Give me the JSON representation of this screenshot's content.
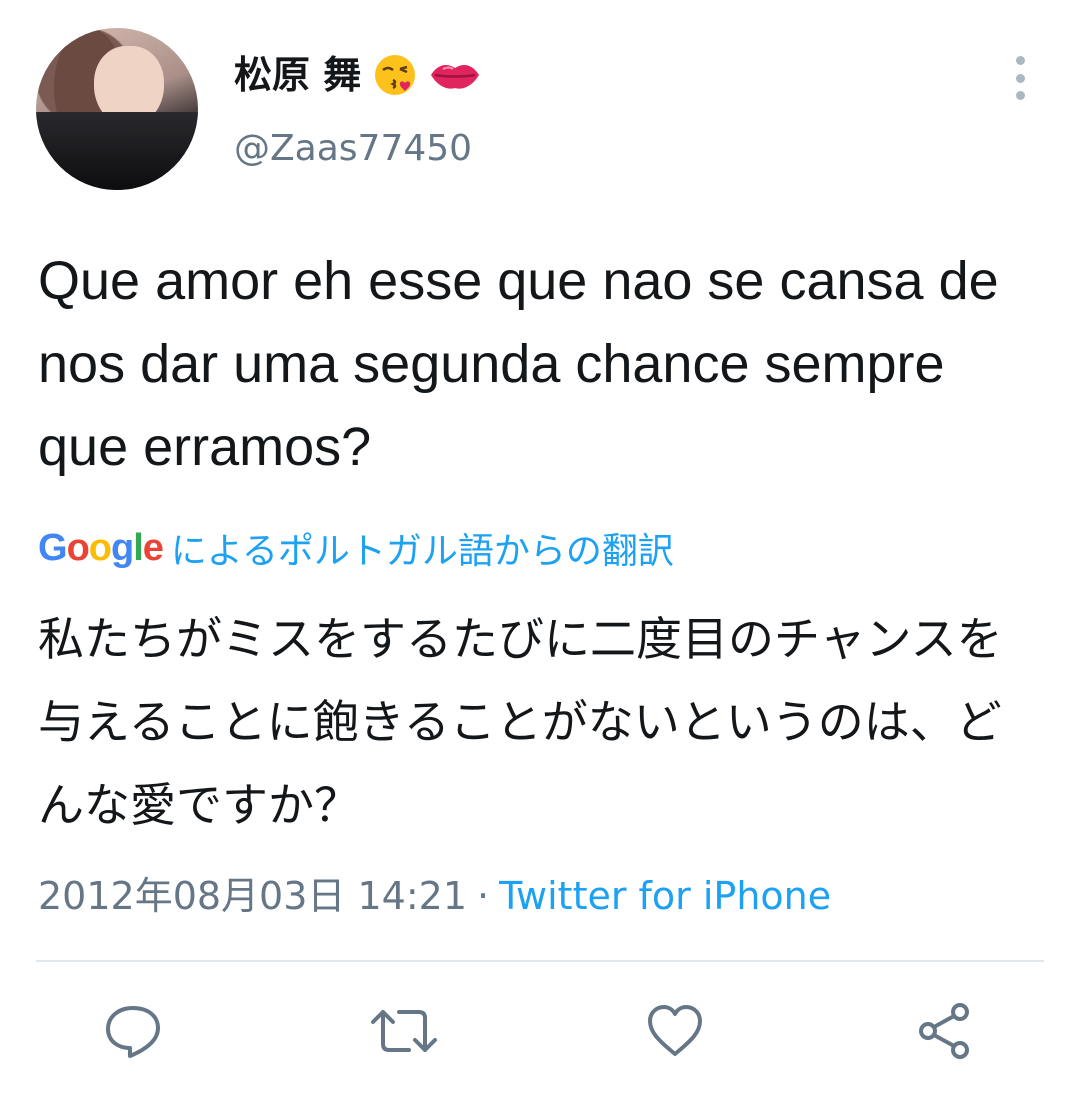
{
  "user": {
    "display_name": "松原 舞",
    "emojis": [
      "kissing-face-emoji",
      "lips-emoji"
    ],
    "handle": "@Zaas77450"
  },
  "tweet": {
    "text": "Que amor eh esse que nao se cansa de nos dar uma segunda chance sempre que erramos?",
    "translation_label": "によるポルトガル語からの翻訳",
    "translation_provider": "Google",
    "translated_text": "私たちがミスをするたびに二度目のチャンスを与えることに飽きることがないというのは、どんな愛ですか？",
    "timestamp": "2012年08月03日 14:21",
    "separator": "·",
    "source": "Twitter for iPhone"
  },
  "actions": [
    "reply-icon",
    "retweet-icon",
    "like-icon",
    "share-icon"
  ],
  "colors": {
    "link": "#1da1f2",
    "secondary_text": "#657786",
    "icon": "#657786",
    "divider": "#e1e8ed"
  }
}
